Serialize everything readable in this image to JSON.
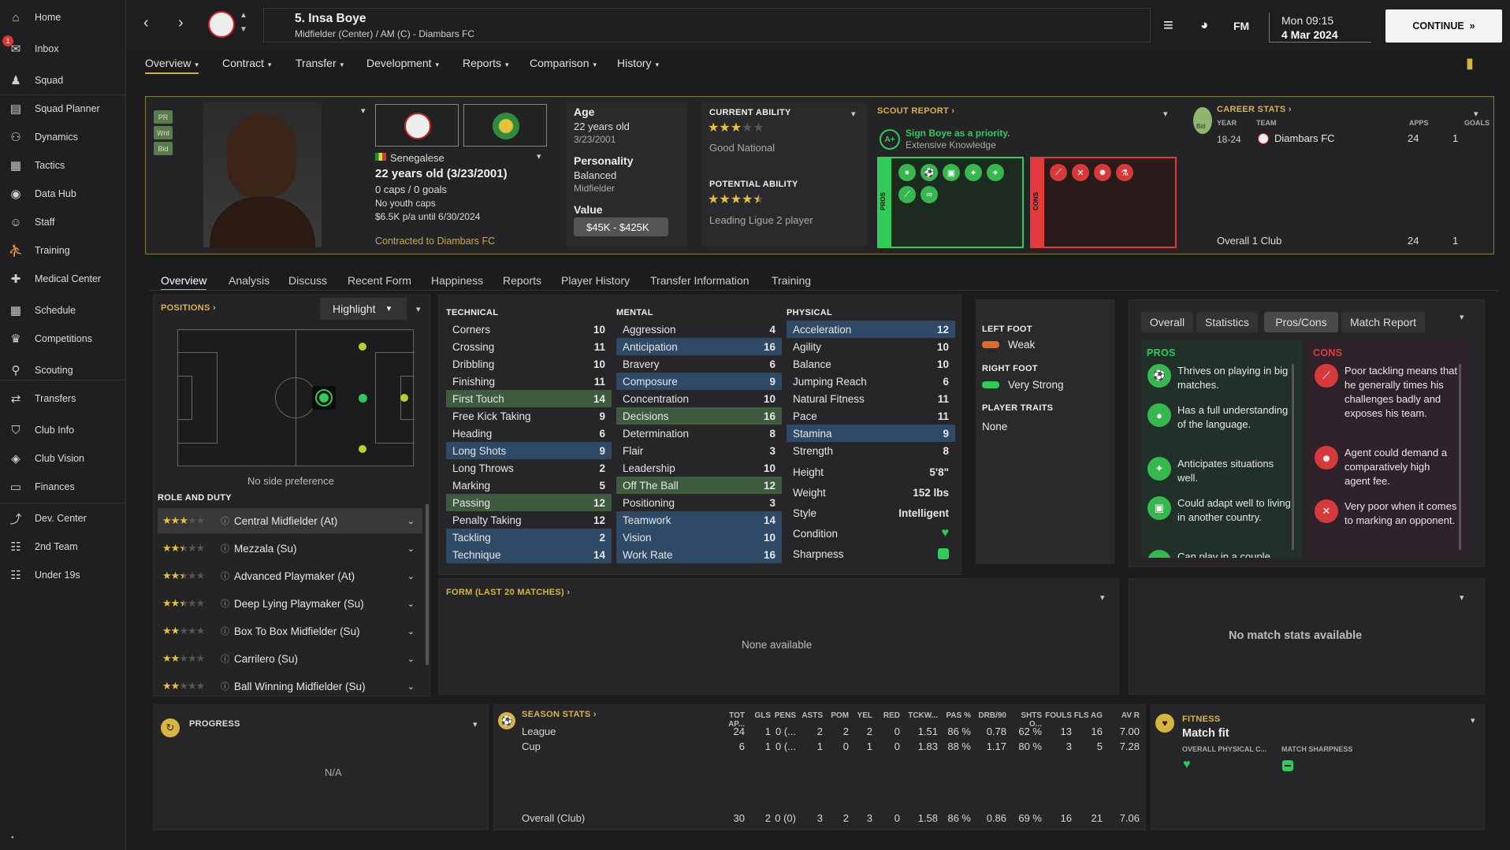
{
  "sidebar": {
    "items": [
      {
        "label": "Home",
        "icon": "home-icon"
      },
      {
        "label": "Inbox",
        "icon": "inbox-icon"
      },
      {
        "label": "Squad",
        "icon": "squad-icon"
      },
      {
        "label": "Squad Planner",
        "icon": "planner-icon"
      },
      {
        "label": "Dynamics",
        "icon": "dynamics-icon"
      },
      {
        "label": "Tactics",
        "icon": "tactics-icon"
      },
      {
        "label": "Data Hub",
        "icon": "data-hub-icon"
      },
      {
        "label": "Staff",
        "icon": "staff-icon"
      },
      {
        "label": "Training",
        "icon": "training-icon"
      },
      {
        "label": "Medical Center",
        "icon": "medical-icon"
      },
      {
        "label": "Schedule",
        "icon": "calendar-icon"
      },
      {
        "label": "Competitions",
        "icon": "trophy-icon"
      },
      {
        "label": "Scouting",
        "icon": "scouting-icon"
      },
      {
        "label": "Transfers",
        "icon": "transfers-icon"
      },
      {
        "label": "Club Info",
        "icon": "shield-icon"
      },
      {
        "label": "Club Vision",
        "icon": "vision-icon"
      },
      {
        "label": "Finances",
        "icon": "finances-icon"
      },
      {
        "label": "Dev. Center",
        "icon": "dev-center-icon"
      },
      {
        "label": "2nd Team",
        "icon": "team-icon"
      },
      {
        "label": "Under 19s",
        "icon": "team-icon"
      }
    ],
    "inbox_badge": "1"
  },
  "header": {
    "player_name": "5. Insa Boye",
    "player_sub": "Midfielder (Center) / AM (C) - Diambars FC",
    "fm_label": "FM",
    "time": "Mon 09:15",
    "date": "4 Mar 2024",
    "continue_label": "CONTINUE"
  },
  "top_tabs": [
    "Overview",
    "Contract",
    "Transfer",
    "Development",
    "Reports",
    "Comparison",
    "History"
  ],
  "profile": {
    "tags": [
      "PR",
      "Wnt",
      "Bid"
    ],
    "nationality": "Senegalese",
    "age_line": "22 years old (3/23/2001)",
    "caps": "0 caps / 0 goals",
    "youth_caps": "No youth caps",
    "wage": "$6.5K p/a until 6/30/2024",
    "contracted": "Contracted to Diambars FC",
    "age_label": "Age",
    "age_value": "22 years old",
    "dob": "3/23/2001",
    "personality_label": "Personality",
    "personality_value": "Balanced",
    "position_text": "Midfielder",
    "value_label": "Value",
    "value_range": "$45K - $425K"
  },
  "ability": {
    "current_label": "CURRENT ABILITY",
    "current_stars": 3,
    "current_text": "Good National",
    "potential_label": "POTENTIAL ABILITY",
    "potential_stars": 4.5,
    "potential_text": "Leading Ligue 2 player"
  },
  "scout": {
    "title": "SCOUT REPORT",
    "grade": "A+",
    "recommendation": "Sign Boye as a priority.",
    "knowledge": "Extensive Knowledge",
    "pros_label": "PROS",
    "cons_label": "CONS"
  },
  "career": {
    "title": "CAREER STATS",
    "col_year": "YEAR",
    "col_team": "TEAM",
    "col_apps": "APPS",
    "col_goals": "GOALS",
    "year": "18-24",
    "team": "Diambars FC",
    "apps": "24",
    "goals": "1",
    "overall_label": "Overall 1 Club",
    "overall_apps": "24",
    "overall_goals": "1",
    "loan_tag": "Bid"
  },
  "sub_tabs": [
    "Overview",
    "Analysis",
    "Discuss",
    "Recent Form",
    "Happiness",
    "Reports",
    "Player History",
    "Transfer Information",
    "Training"
  ],
  "positions": {
    "title": "POSITIONS",
    "highlight": "Highlight",
    "side_pref": "No side preference",
    "role_title": "ROLE AND DUTY",
    "roles": [
      {
        "name": "Central Midfielder (At)",
        "stars": 3
      },
      {
        "name": "Mezzala (Su)",
        "stars": 2.5
      },
      {
        "name": "Advanced Playmaker (At)",
        "stars": 2.5
      },
      {
        "name": "Deep Lying Playmaker (Su)",
        "stars": 2.5
      },
      {
        "name": "Box To Box Midfielder (Su)",
        "stars": 2
      },
      {
        "name": "Carrilero (Su)",
        "stars": 2
      },
      {
        "name": "Ball Winning Midfielder (Su)",
        "stars": 2
      }
    ]
  },
  "attributes": {
    "technical_title": "TECHNICAL",
    "mental_title": "MENTAL",
    "physical_title": "PHYSICAL",
    "technical": [
      {
        "name": "Corners",
        "value": "10",
        "hl": ""
      },
      {
        "name": "Crossing",
        "value": "11",
        "hl": ""
      },
      {
        "name": "Dribbling",
        "value": "10",
        "hl": ""
      },
      {
        "name": "Finishing",
        "value": "11",
        "hl": ""
      },
      {
        "name": "First Touch",
        "value": "14",
        "hl": "green"
      },
      {
        "name": "Free Kick Taking",
        "value": "9",
        "hl": ""
      },
      {
        "name": "Heading",
        "value": "6",
        "hl": ""
      },
      {
        "name": "Long Shots",
        "value": "9",
        "hl": "blue"
      },
      {
        "name": "Long Throws",
        "value": "2",
        "hl": ""
      },
      {
        "name": "Marking",
        "value": "5",
        "hl": ""
      },
      {
        "name": "Passing",
        "value": "12",
        "hl": "green"
      },
      {
        "name": "Penalty Taking",
        "value": "12",
        "hl": ""
      },
      {
        "name": "Tackling",
        "value": "2",
        "hl": "blue"
      },
      {
        "name": "Technique",
        "value": "14",
        "hl": "blue"
      }
    ],
    "mental": [
      {
        "name": "Aggression",
        "value": "4",
        "hl": ""
      },
      {
        "name": "Anticipation",
        "value": "16",
        "hl": "blue"
      },
      {
        "name": "Bravery",
        "value": "6",
        "hl": ""
      },
      {
        "name": "Composure",
        "value": "9",
        "hl": "blue"
      },
      {
        "name": "Concentration",
        "value": "10",
        "hl": ""
      },
      {
        "name": "Decisions",
        "value": "16",
        "hl": "green"
      },
      {
        "name": "Determination",
        "value": "8",
        "hl": ""
      },
      {
        "name": "Flair",
        "value": "3",
        "hl": ""
      },
      {
        "name": "Leadership",
        "value": "10",
        "hl": ""
      },
      {
        "name": "Off The Ball",
        "value": "12",
        "hl": "green"
      },
      {
        "name": "Positioning",
        "value": "3",
        "hl": ""
      },
      {
        "name": "Teamwork",
        "value": "14",
        "hl": "blue"
      },
      {
        "name": "Vision",
        "value": "10",
        "hl": "blue"
      },
      {
        "name": "Work Rate",
        "value": "16",
        "hl": "blue"
      }
    ],
    "physical": [
      {
        "name": "Acceleration",
        "value": "12",
        "hl": "blue"
      },
      {
        "name": "Agility",
        "value": "10",
        "hl": ""
      },
      {
        "name": "Balance",
        "value": "10",
        "hl": ""
      },
      {
        "name": "Jumping Reach",
        "value": "6",
        "hl": ""
      },
      {
        "name": "Natural Fitness",
        "value": "11",
        "hl": ""
      },
      {
        "name": "Pace",
        "value": "11",
        "hl": ""
      },
      {
        "name": "Stamina",
        "value": "9",
        "hl": "blue"
      },
      {
        "name": "Strength",
        "value": "8",
        "hl": ""
      }
    ],
    "extra": [
      {
        "name": "Height",
        "value": "5'8\""
      },
      {
        "name": "Weight",
        "value": "152 lbs"
      },
      {
        "name": "Style",
        "value": "Intelligent"
      },
      {
        "name": "Condition",
        "value": ""
      },
      {
        "name": "Sharpness",
        "value": ""
      }
    ]
  },
  "feet": {
    "left_label": "LEFT FOOT",
    "left_value": "Weak",
    "right_label": "RIGHT FOOT",
    "right_value": "Very Strong",
    "traits_label": "PLAYER TRAITS",
    "traits_value": "None"
  },
  "procons": {
    "tabs": [
      "Overall",
      "Statistics",
      "Pros/Cons",
      "Match Report"
    ],
    "pros_title": "PROS",
    "cons_title": "CONS",
    "pros": [
      "Thrives on playing in big matches.",
      "Has a full understanding of the language.",
      "Anticipates situations well.",
      "Could adapt well to living in another country.",
      "Can play in a couple"
    ],
    "cons": [
      "Poor tackling means that he generally times his challenges badly and exposes his team.",
      "Agent could demand a comparatively high agent fee.",
      "Very poor when it comes to marking an opponent."
    ]
  },
  "form": {
    "title": "FORM (LAST 20 MATCHES)",
    "empty": "None available",
    "match_stats_empty": "No match stats available"
  },
  "progress": {
    "title": "PROGRESS",
    "value": "N/A"
  },
  "season": {
    "title": "SEASON STATS",
    "columns": [
      "TOT AP...",
      "GLS",
      "PENS",
      "ASTS",
      "POM",
      "YEL",
      "RED",
      "TCKW...",
      "PAS %",
      "DRB/90",
      "SHTS O...",
      "FOULS",
      "FLS AG",
      "AV R"
    ],
    "rows": [
      {
        "label": "League",
        "cells": [
          "24",
          "1",
          "0 (...",
          "2",
          "2",
          "2",
          "0",
          "1.51",
          "86 %",
          "0.78",
          "62 %",
          "13",
          "16",
          "7.00"
        ]
      },
      {
        "label": "Cup",
        "cells": [
          "6",
          "1",
          "0 (...",
          "1",
          "0",
          "1",
          "0",
          "1.83",
          "88 %",
          "1.17",
          "80 %",
          "3",
          "5",
          "7.28"
        ]
      },
      {
        "label": "Overall (Club)",
        "cells": [
          "30",
          "2",
          "0 (0)",
          "3",
          "2",
          "3",
          "0",
          "1.58",
          "86 %",
          "0.86",
          "69 %",
          "16",
          "21",
          "7.06"
        ]
      }
    ]
  },
  "fitness": {
    "title": "FITNESS",
    "status": "Match fit",
    "col1": "OVERALL PHYSICAL C...",
    "col2": "MATCH SHARPNESS"
  },
  "colors": {
    "accent": "#d8b441",
    "pros": "#2fcb5b",
    "cons": "#e33b3b",
    "highlight_blue": "#2e4a66",
    "highlight_green": "#3f5b3e"
  }
}
